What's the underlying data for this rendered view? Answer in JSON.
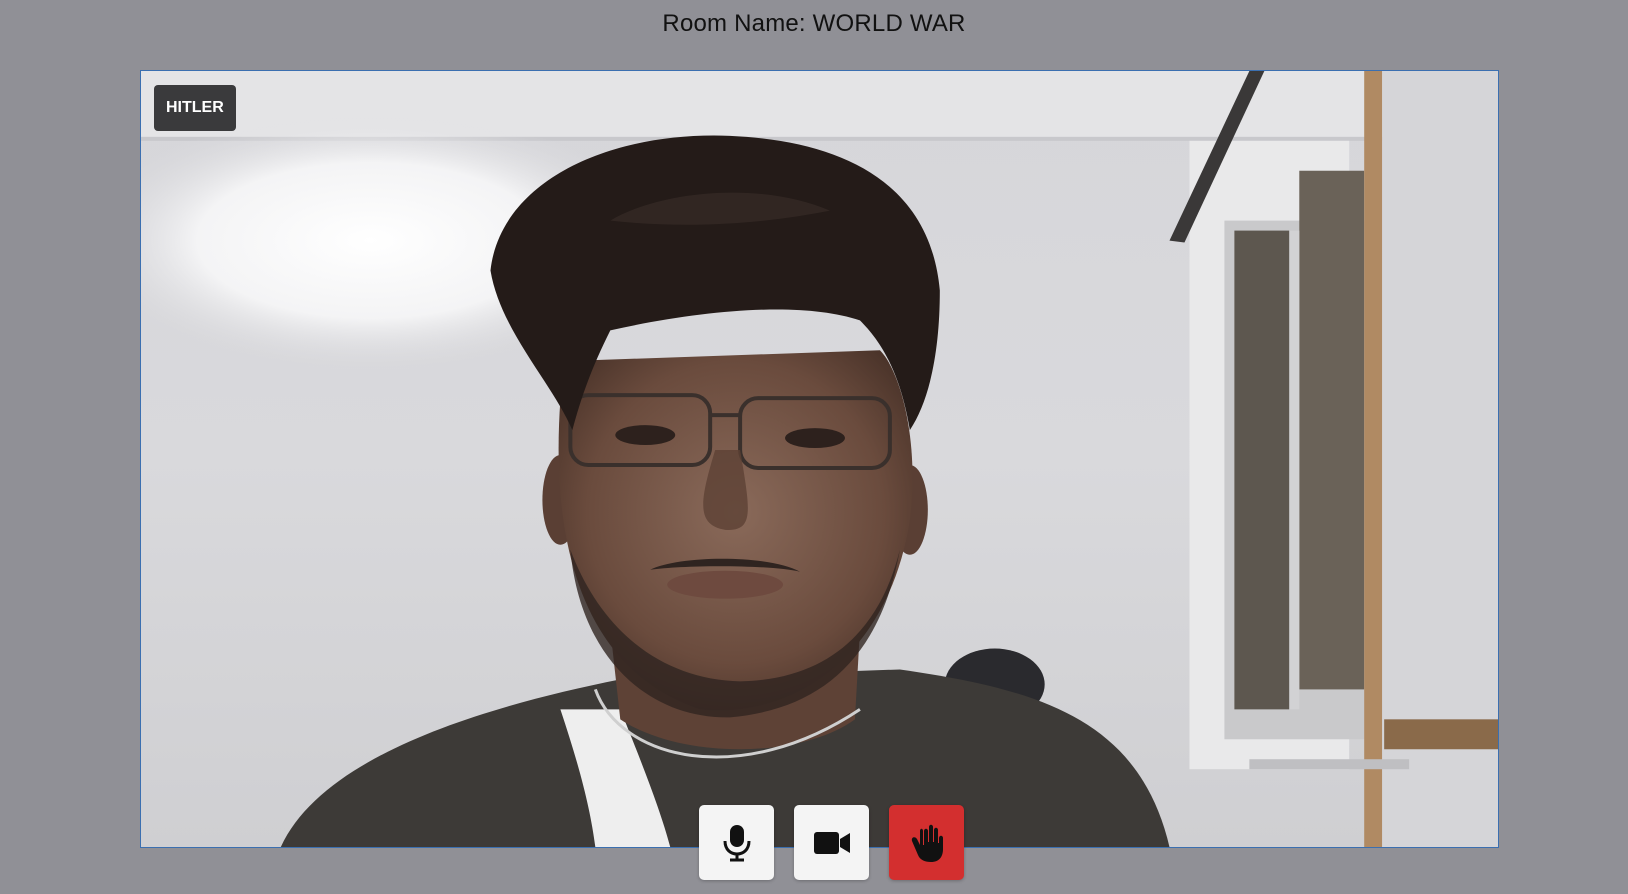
{
  "header": {
    "room_title": "Room Name: WORLD WAR"
  },
  "video": {
    "participant_name": "HITLER"
  },
  "controls": {
    "mic_icon": "microphone-icon",
    "camera_icon": "video-camera-icon",
    "leave_icon": "hand-icon",
    "leave_color": "#d32f2f"
  },
  "colors": {
    "background": "#909096",
    "tile_border": "#3b6fb0",
    "name_tag_bg": "#3a3a3c"
  }
}
